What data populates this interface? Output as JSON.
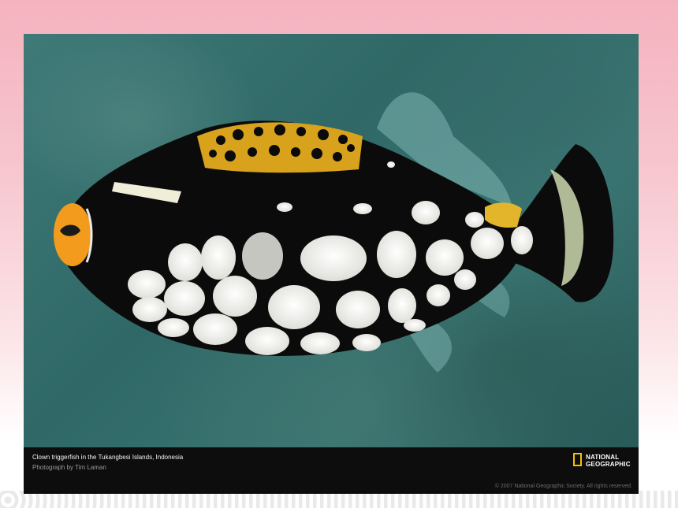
{
  "caption": {
    "title": "Clown triggerfish in the Tukangbesi Islands, Indonesia",
    "credit": "Photograph by Tim Laman",
    "copyright": "© 2007 National Geographic Society. All rights reserved."
  },
  "logo": {
    "line1": "NATIONAL",
    "line2": "GEOGRAPHIC"
  },
  "colors": {
    "page_top": "#f4b3bf",
    "water": "#2f6866",
    "fish_body": "#0b0b0b",
    "spots": "#f4f4f0",
    "mouth": "#f29b1d",
    "dorsal_pattern": "#d8a21c",
    "logo_accent": "#f3c200"
  }
}
